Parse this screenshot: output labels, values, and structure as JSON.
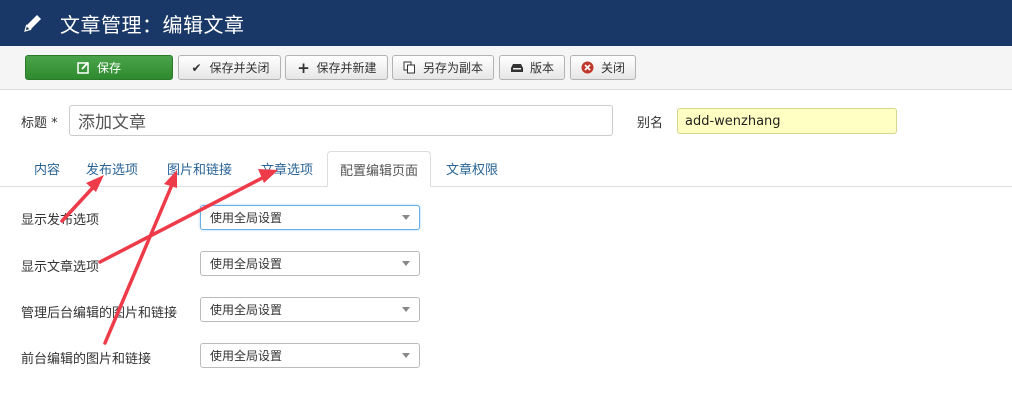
{
  "header": {
    "title": "文章管理：编辑文章",
    "icon": "pencil-icon"
  },
  "toolbar": {
    "save": "保存",
    "save_close": "保存并关闭",
    "save_new": "保存并新建",
    "save_copy": "另存为副本",
    "versions": "版本",
    "close": "关闭"
  },
  "form": {
    "title_label": "标题 *",
    "title_value": "添加文章",
    "alias_label": "别名",
    "alias_value": "add-wenzhang"
  },
  "tabs": [
    {
      "label": "内容",
      "active": false
    },
    {
      "label": "发布选项",
      "active": false
    },
    {
      "label": "图片和链接",
      "active": false
    },
    {
      "label": "文章选项",
      "active": false
    },
    {
      "label": "配置编辑页面",
      "active": true
    },
    {
      "label": "文章权限",
      "active": false
    }
  ],
  "fields": [
    {
      "label": "显示发布选项",
      "value": "使用全局设置"
    },
    {
      "label": "显示文章选项",
      "value": "使用全局设置"
    },
    {
      "label": "管理后台编辑的图片和链接",
      "value": "使用全局设置"
    },
    {
      "label": "前台编辑的图片和链接",
      "value": "使用全局设置"
    }
  ],
  "colors": {
    "header_bg": "#1a3867",
    "primary_button": "#3c9a3c",
    "annotation_arrow": "#ee3b4a",
    "link": "#2a6496",
    "alias_bg": "#ffffc3"
  }
}
